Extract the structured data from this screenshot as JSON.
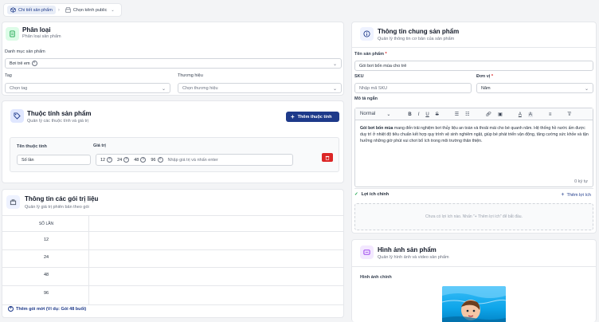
{
  "breadcrumb": {
    "items": [
      {
        "label": "Chi tiết sản phẩm",
        "icon": "box-icon",
        "active": true
      },
      {
        "label": "Chọn kênh public",
        "icon": "store-icon",
        "active": false
      }
    ]
  },
  "classification": {
    "title": "Phân loại",
    "subtitle": "Phân loại sản phẩm",
    "category_label": "Danh mục sản phẩm",
    "category_value": "Bơi trẻ em",
    "tag_label": "Tag",
    "tag_placeholder": "Chọn tag",
    "brand_label": "Thương hiệu",
    "brand_placeholder": "Chọn thương hiệu"
  },
  "attributes": {
    "title": "Thuộc tính sản phẩm",
    "subtitle": "Quản lý các thuộc tính và giá trị",
    "add_button": "Thêm thuộc tính",
    "name_label": "Tên thuộc tính",
    "value_label": "Giá trị",
    "name_value": "Số lần",
    "values": [
      "12",
      "24",
      "48",
      "96"
    ],
    "value_placeholder": "Nhập giá trị và nhấn enter"
  },
  "packages": {
    "title": "Thông tin các gói trị liệu",
    "subtitle": "Quản lý giá trị phiên bản theo gói",
    "column_header": "SỐ LẦN",
    "rows": [
      "12",
      "24",
      "48",
      "96"
    ],
    "add_link": "Thêm gói mới (Ví dụ: Gói 48 buổi)"
  },
  "general": {
    "title": "Thông tin chung sản phẩm",
    "subtitle": "Quản lý thông tin cơ bản của sản phẩm",
    "name_label": "Tên sản phẩm",
    "required_mark": "*",
    "name_value": "Gói bơi bốn mùa cho trẻ",
    "sku_label": "SKU",
    "sku_placeholder": "Nhập mã SKU",
    "unit_label": "Đơn vị",
    "unit_value": "Năm",
    "desc_label": "Mô tả ngắn",
    "toolbar_format": "Normal",
    "desc_bold": "Gói bơi bốn mùa",
    "desc_text": " mang đến trải nghiệm bơi thủy liệu an toàn và thoải mái cho bé quanh năm. Hệ thống hồ nước ấm được duy trì ở nhiệt độ tiêu chuẩn kết hợp quy trình vệ sinh nghiêm ngặt, giúp bé phát triển vận động, tăng cường sức khỏe và tận hưởng những giờ phút vui chơi bổ ích trong môi trường thân thiện.",
    "char_count": "0 ký tự",
    "benefits_label": "Lợi ích chính",
    "add_benefit": "Thêm lợi ích",
    "benefits_empty": "Chưa có lợi ích nào. Nhấn \"+ Thêm lợi ích\" để bắt đầu."
  },
  "images": {
    "title": "Hình ảnh sản phẩm",
    "subtitle": "Quản lý hình ảnh và video sản phẩm",
    "main_label": "Hình ảnh chính"
  },
  "colors": {
    "accent": "#1e3a8a",
    "green": "#16a34a",
    "danger": "#dc2626"
  }
}
